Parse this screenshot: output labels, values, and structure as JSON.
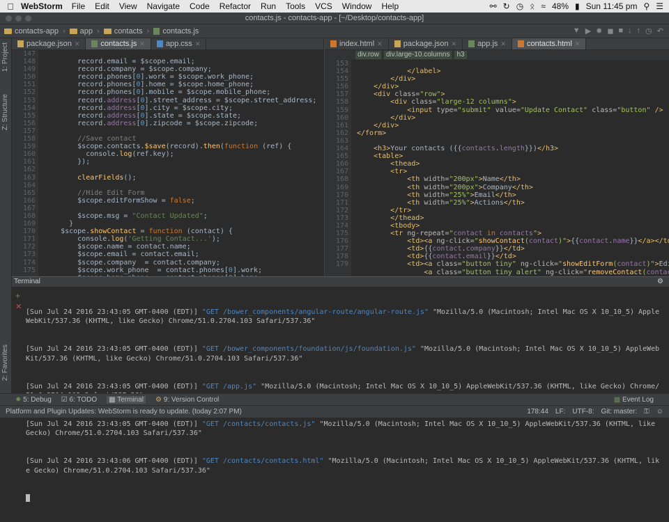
{
  "menubar": {
    "app": "WebStorm",
    "items": [
      "File",
      "Edit",
      "View",
      "Navigate",
      "Code",
      "Refactor",
      "Run",
      "Tools",
      "VCS",
      "Window",
      "Help"
    ],
    "battery": "48%",
    "clock": "Sun 11:45 pm"
  },
  "window": {
    "title": "contacts.js - contacts-app - [~/Desktop/contacts-app]"
  },
  "nav": {
    "crumbs": [
      "contacts-app",
      "app",
      "contacts",
      "contacts.js"
    ]
  },
  "left_tabs": {
    "project": "1: Project",
    "structure": "Z: Structure",
    "favorites": "2: Favorites"
  },
  "editor_left": {
    "tabs": [
      {
        "label": "package.json"
      },
      {
        "label": "contacts.js"
      },
      {
        "label": "app.css"
      }
    ],
    "line_numbers": [
      "147",
      "148",
      "149",
      "150",
      "151",
      "152",
      "153",
      "154",
      "155",
      "156",
      "157",
      "158",
      "159",
      "160",
      "161",
      "162",
      "163",
      "164",
      "165",
      "166",
      "167",
      "168",
      "169",
      "170",
      "171",
      "172",
      "173",
      "174",
      "175"
    ]
  },
  "editor_right": {
    "tabs": [
      {
        "label": "index.html"
      },
      {
        "label": "package.json"
      },
      {
        "label": "app.js"
      },
      {
        "label": "contacts.html"
      }
    ],
    "breadcrumbs": [
      "div.row",
      "div.large-10.columns",
      "h3"
    ],
    "line_numbers": [
      "153",
      "154",
      "155",
      "156",
      "157",
      "158",
      "159",
      "160",
      "161",
      "162",
      "163",
      "164",
      "165",
      "166",
      "167",
      "168",
      "169",
      "170",
      "171",
      "172",
      "173",
      "174",
      "175",
      "176",
      "177",
      "178",
      "179"
    ]
  },
  "terminal": {
    "title": "Terminal",
    "lines": [
      {
        "ts": "[Sun Jul 24 2016 23:43:05 GMT-0400 (EDT)] ",
        "req": "\"GET /bower_components/angular-route/angular-route.js\"",
        "ua": " \"Mozilla/5.0 (Macintosh; Intel Mac OS X 10_10_5) AppleWebKit/537.36 (KHTML, like Gecko) Chrome/51.0.2704.103 Safari/537.36\""
      },
      {
        "ts": "[Sun Jul 24 2016 23:43:05 GMT-0400 (EDT)] ",
        "req": "\"GET /bower_components/foundation/js/foundation.js\"",
        "ua": " \"Mozilla/5.0 (Macintosh; Intel Mac OS X 10_10_5) AppleWebKit/537.36 (KHTML, like Gecko) Chrome/51.0.2704.103 Safari/537.36\""
      },
      {
        "ts": "[Sun Jul 24 2016 23:43:05 GMT-0400 (EDT)] ",
        "req": "\"GET /app.js\"",
        "ua": " \"Mozilla/5.0 (Macintosh; Intel Mac OS X 10_10_5) AppleWebKit/537.36 (KHTML, like Gecko) Chrome/51.0.2704.103 Safari/537.36\""
      },
      {
        "ts": "[Sun Jul 24 2016 23:43:05 GMT-0400 (EDT)] ",
        "req": "\"GET /contacts/contacts.js\"",
        "ua": " \"Mozilla/5.0 (Macintosh; Intel Mac OS X 10_10_5) AppleWebKit/537.36 (KHTML, like Gecko) Chrome/51.0.2704.103 Safari/537.36\""
      },
      {
        "ts": "[Sun Jul 24 2016 23:43:06 GMT-0400 (EDT)] ",
        "req": "\"GET /contacts/contacts.html\"",
        "ua": " \"Mozilla/5.0 (Macintosh; Intel Mac OS X 10_10_5) AppleWebKit/537.36 (KHTML, like Gecko) Chrome/51.0.2704.103 Safari/537.36\""
      }
    ]
  },
  "bottom_tools": {
    "debug": "5: Debug",
    "todo": "6: TODO",
    "terminal": "Terminal",
    "vc": "9: Version Control",
    "eventlog": "Event Log"
  },
  "status": {
    "message": "Platform and Plugin Updates: WebStorm is ready to update. (today 2:07 PM)",
    "position": "178:44",
    "line_sep": "LF:",
    "encoding": "UTF-8:",
    "branch": "Git: master:"
  },
  "colors": {
    "accent": "#4a88c7",
    "bg": "#2b2b2b",
    "keyword": "#cc7832",
    "string": "#6a8759"
  }
}
